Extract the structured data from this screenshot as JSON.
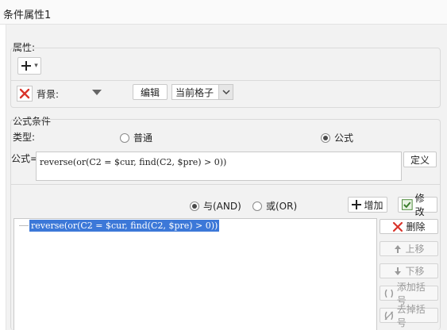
{
  "window": {
    "title": "条件属性1"
  },
  "attributes": {
    "section_label": "属性:",
    "add_dropdown_arrow": "▾",
    "background_label": "背景:",
    "edit_label": "编辑",
    "scope_value": "当前格子"
  },
  "formula": {
    "section_label": "公式条件",
    "type_label": "类型:",
    "type_options": [
      "普通",
      "公式"
    ],
    "selected_type": "公式",
    "formula_label": "公式=",
    "formula_value": "reverse(or(C2 = $cur, find(C2, $pre) > 0))",
    "define_label": "定义"
  },
  "logic": {
    "options": [
      "与(AND)",
      "或(OR)"
    ],
    "selected": "与(AND)"
  },
  "actions": {
    "add_label": "增加",
    "modify_label": "修改"
  },
  "conditions": {
    "items": [
      "reverse(or(C2 = $cur, find(C2, $pre) > 0))"
    ],
    "selected_index": 0
  },
  "side_buttons": {
    "delete_label": "删除",
    "move_up_label": "上移",
    "move_down_label": "下移",
    "add_bracket_label": "添加括号",
    "remove_bracket_label": "去掉括号"
  },
  "colors": {
    "selection": "#3c78d8",
    "delete_red": "#d9342b",
    "panel_bg": "#f2f2f2"
  }
}
